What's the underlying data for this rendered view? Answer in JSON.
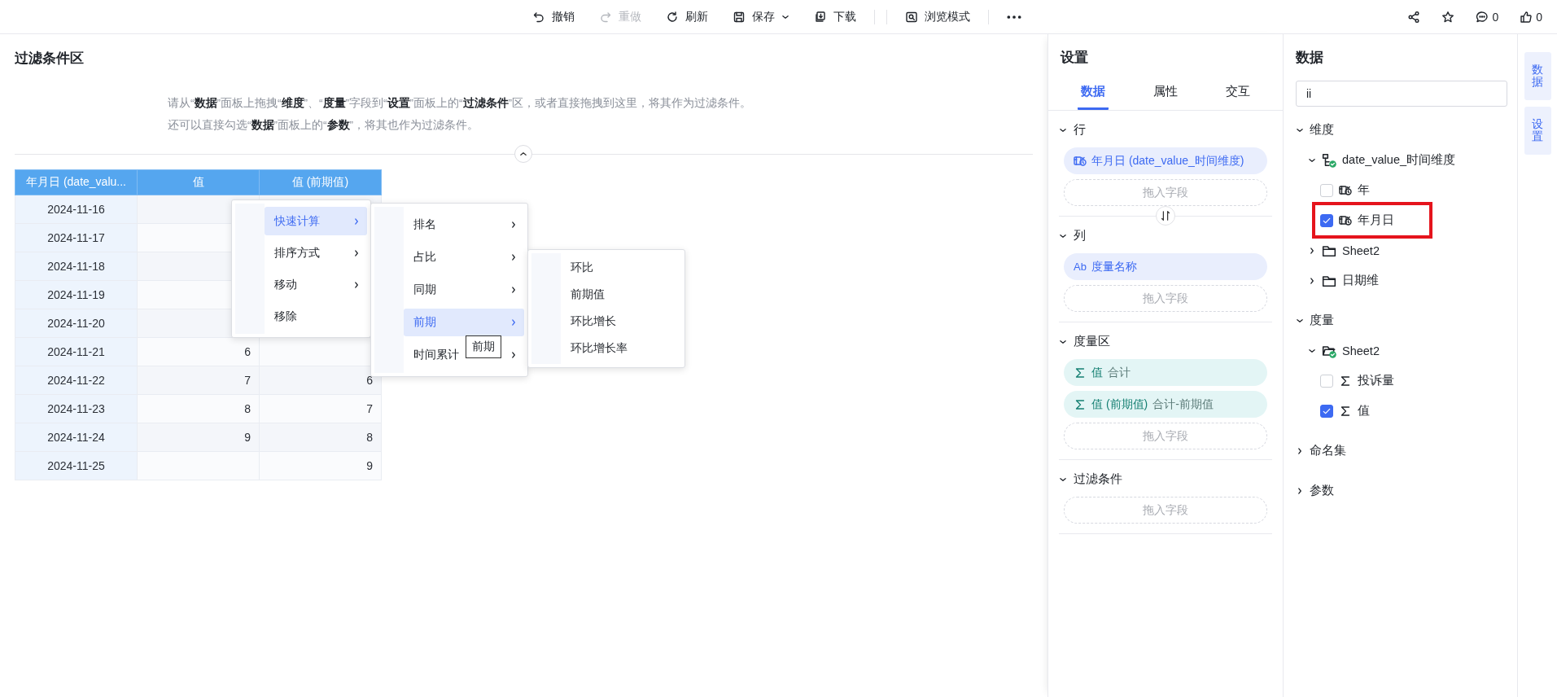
{
  "toolbar": {
    "items": [
      {
        "kind": "undo",
        "label": "撤销",
        "disabled": false
      },
      {
        "kind": "redo",
        "label": "重做",
        "disabled": true
      },
      {
        "kind": "refresh",
        "label": "刷新",
        "disabled": false
      },
      {
        "kind": "save",
        "label": "保存",
        "disabled": false,
        "dropdown": true
      },
      {
        "kind": "download",
        "label": "下载",
        "disabled": false
      },
      {
        "kind": "preview",
        "label": "浏览模式",
        "disabled": false
      }
    ],
    "comments": "0",
    "likes": "0"
  },
  "filter_area": {
    "title": "过滤条件区",
    "hint_lines": [
      "请从“**数据**”面板上拖拽“**维度**”、“**度量**”字段到“**设置**”面板上的“**过滤条件**”区，或者直接拖拽到这里，将其作为过滤条件。",
      "还可以直接勾选“**数据**”面板上的“**参数**”，将其也作为过滤条件。"
    ]
  },
  "table": {
    "columns": [
      "年月日 (date_valu...",
      "值",
      "值 (前期值)"
    ],
    "rows": [
      [
        "2024-11-16"
      ],
      [
        "2024-11-17"
      ],
      [
        "2024-11-18"
      ],
      [
        "2024-11-19"
      ],
      [
        "2024-11-20"
      ],
      [
        "2024-11-21",
        "6"
      ],
      [
        "2024-11-22",
        "7",
        "6"
      ],
      [
        "2024-11-23",
        "8",
        "7"
      ],
      [
        "2024-11-24",
        "9",
        "8"
      ],
      [
        "2024-11-25",
        "",
        "9"
      ]
    ]
  },
  "context_menus": [
    {
      "items": [
        {
          "label": "快速计算",
          "submenu": true,
          "selected": true
        },
        {
          "label": "排序方式",
          "submenu": true,
          "selected": false
        },
        {
          "label": "移动",
          "submenu": true,
          "selected": false
        },
        {
          "label": "移除",
          "submenu": false,
          "selected": false
        }
      ]
    },
    {
      "items": [
        {
          "label": "排名",
          "submenu": true,
          "selected": false
        },
        {
          "label": "占比",
          "submenu": true,
          "selected": false
        },
        {
          "label": "同期",
          "submenu": true,
          "selected": false
        },
        {
          "label": "前期",
          "submenu": true,
          "selected": true
        },
        {
          "label": "时间累计",
          "submenu": true,
          "selected": false
        }
      ]
    },
    {
      "items": [
        {
          "label": "环比",
          "submenu": false,
          "selected": false
        },
        {
          "label": "前期值",
          "submenu": false,
          "selected": false
        },
        {
          "label": "环比增长",
          "submenu": false,
          "selected": false
        },
        {
          "label": "环比增长率",
          "submenu": false,
          "selected": false
        }
      ]
    }
  ],
  "tooltip": "前期",
  "settings": {
    "title": "设置",
    "tabs": [
      {
        "label": "数据",
        "selected": true
      },
      {
        "label": "属性",
        "selected": false
      },
      {
        "label": "交互",
        "selected": false
      }
    ],
    "sections": [
      {
        "title": "行",
        "expanded": true,
        "swap": true,
        "fields": [
          {
            "kind": "date",
            "label": "年月日 (date_value_时间维度)"
          }
        ],
        "placeholder": "拖入字段"
      },
      {
        "title": "列",
        "expanded": true,
        "fields": [
          {
            "kind": "text",
            "glyph": "Ab",
            "label": "度量名称"
          }
        ],
        "placeholder": "拖入字段"
      },
      {
        "title": "度量区",
        "expanded": true,
        "fields": [
          {
            "kind": "measure",
            "label": "值",
            "detail": "合计"
          },
          {
            "kind": "measure",
            "label": "值 (前期值)",
            "detail": "合计-前期值"
          }
        ],
        "placeholder": "拖入字段"
      },
      {
        "title": "过滤条件",
        "expanded": true,
        "placeholder": "拖入字段"
      }
    ]
  },
  "data_panel": {
    "title": "数据",
    "search": {
      "value": "ii"
    },
    "tree": [
      {
        "label": "维度",
        "expanded": true,
        "children": [
          {
            "kind": "hierarchy",
            "label": "date_value_时间维度",
            "expanded": true,
            "children": [
              {
                "kind": "date",
                "label": "年",
                "checked": false,
                "highlighted": false
              },
              {
                "kind": "date",
                "label": "年月日",
                "checked": true,
                "highlighted": true
              }
            ]
          },
          {
            "kind": "folder",
            "label": "Sheet2",
            "expanded": false
          },
          {
            "kind": "folder",
            "label": "日期维",
            "expanded": false
          }
        ]
      },
      {
        "label": "度量",
        "expanded": true,
        "children": [
          {
            "kind": "folder_used",
            "label": "Sheet2",
            "expanded": true,
            "children": [
              {
                "kind": "measure",
                "label": "投诉量",
                "checked": false,
                "highlighted": false
              },
              {
                "kind": "measure",
                "label": "值",
                "checked": true,
                "highlighted": false
              }
            ]
          }
        ]
      },
      {
        "label": "命名集",
        "expanded": false
      },
      {
        "label": "参数",
        "expanded": false
      }
    ]
  },
  "side_tabs": [
    "数据",
    "设置"
  ]
}
